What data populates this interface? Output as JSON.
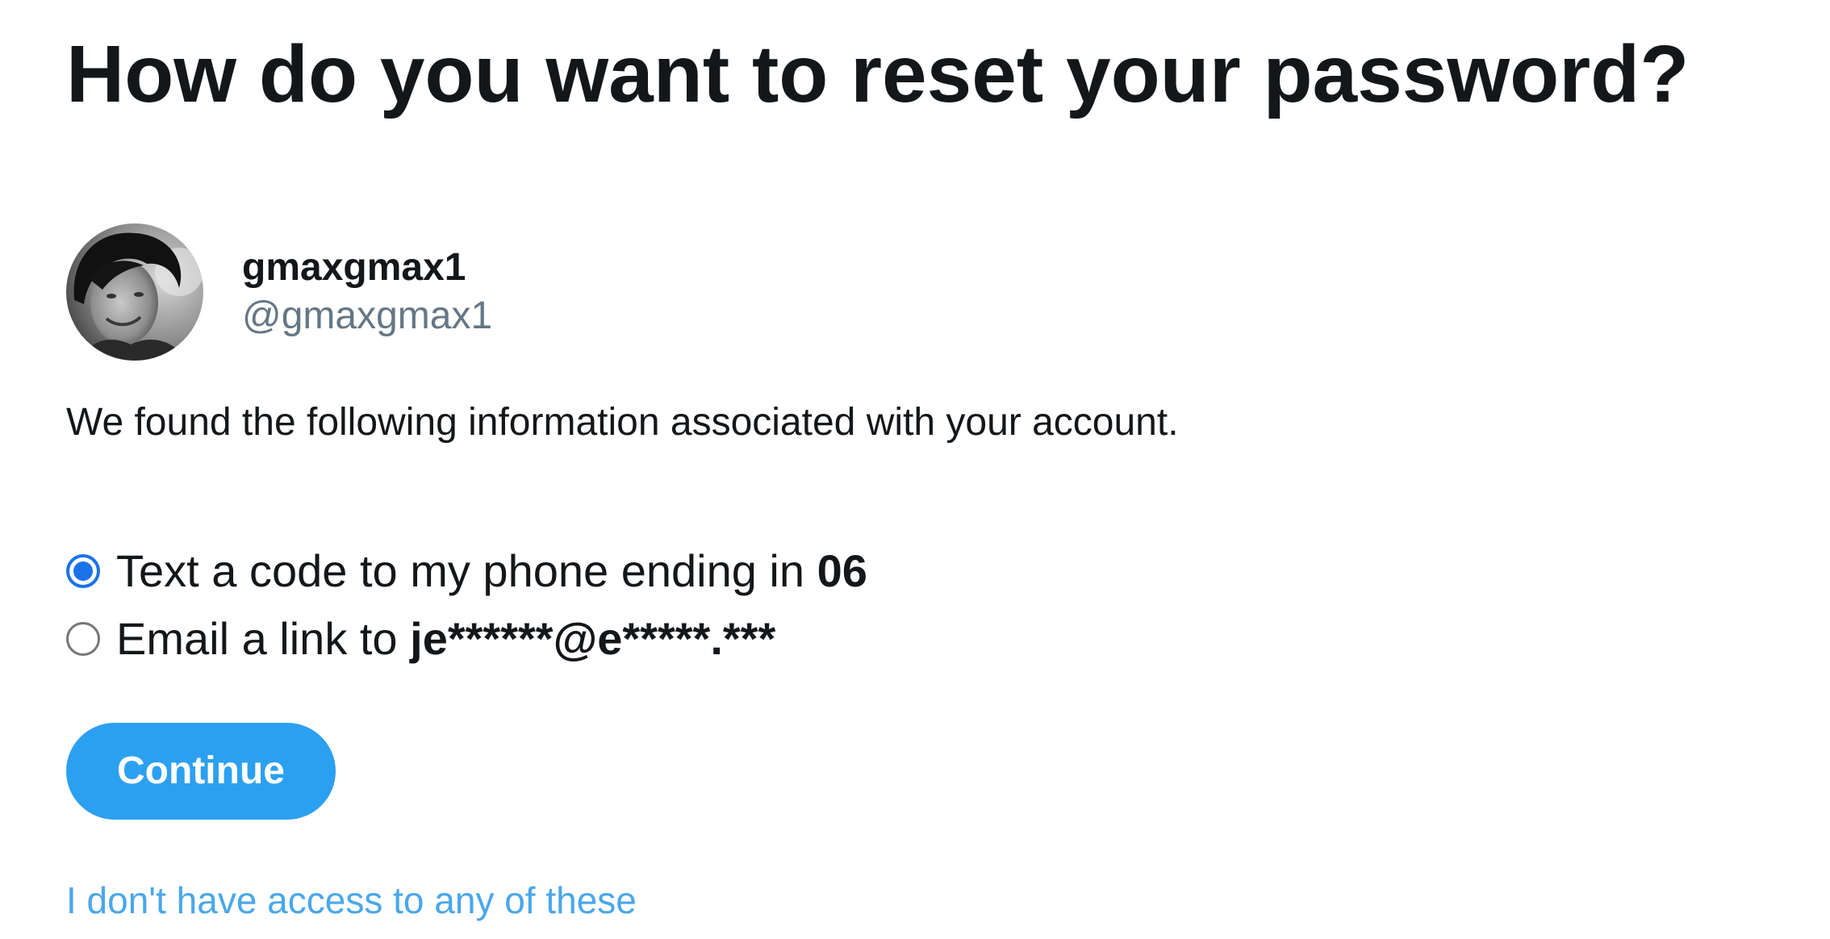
{
  "heading": "How do you want to reset your password?",
  "account": {
    "display_name": "gmaxgmax1",
    "handle": "@gmaxgmax1"
  },
  "info_text": "We found the following information associated with your account.",
  "options": [
    {
      "label_prefix": "Text a code to my phone ending in ",
      "label_value": "06",
      "selected": true
    },
    {
      "label_prefix": "Email a link to ",
      "label_value": "je******@e*****.***",
      "selected": false
    }
  ],
  "continue_label": "Continue",
  "no_access_link": "I don't have access to any of these",
  "colors": {
    "primary_button": "#2ca0f0",
    "link": "#4aa7ea",
    "radio_selected": "#1a73e8",
    "text": "#14171a",
    "muted_text": "#657786"
  }
}
